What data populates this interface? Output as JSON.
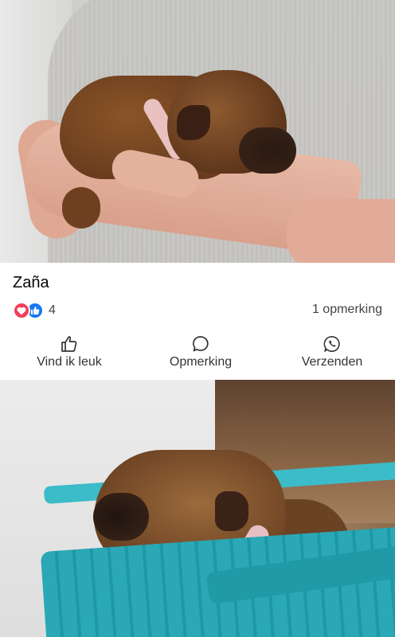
{
  "post": {
    "title": "Zaña",
    "reactions": {
      "icons": [
        "heart-icon",
        "like-icon"
      ],
      "count": "4"
    },
    "comments": "1 opmerking",
    "actions": [
      {
        "label": "Vind ik leuk",
        "icon": "thumbs-up-icon"
      },
      {
        "label": "Opmerking",
        "icon": "comment-bubble-icon"
      },
      {
        "label": "Verzenden",
        "icon": "whatsapp-icon"
      }
    ]
  },
  "colors": {
    "heart": "#f33e58",
    "like": "#1877f2",
    "text": "#333333",
    "divider": "#e4e6eb"
  }
}
